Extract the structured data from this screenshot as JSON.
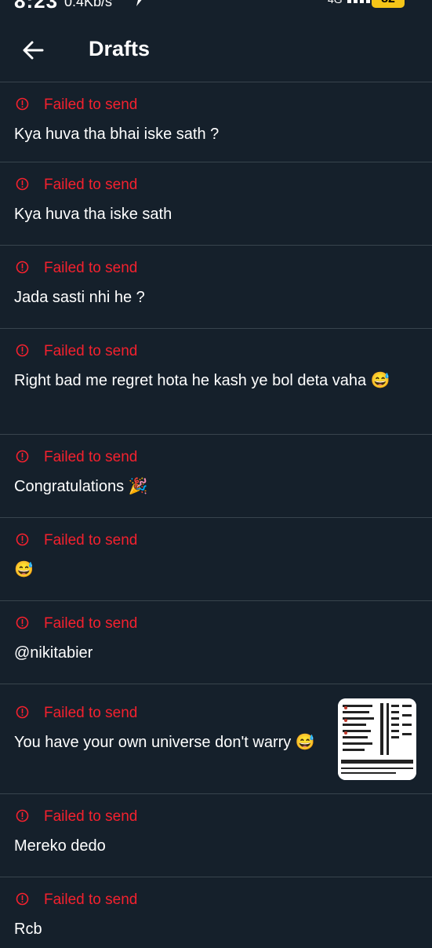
{
  "status_bar": {
    "time": "8:23",
    "net_speed": "0.4Kb/s",
    "network": "4G",
    "battery": "82"
  },
  "header": {
    "title": "Drafts"
  },
  "drafts": [
    {
      "status": "Failed to send",
      "text": "Kya huva tha bhai iske sath ?"
    },
    {
      "status": "Failed to send",
      "text": "Kya huva tha iske sath"
    },
    {
      "status": "Failed to send",
      "text": "Jada sasti nhi he ?"
    },
    {
      "status": "Failed to send",
      "text": "Right bad me regret hota he kash ye bol deta vaha 😅"
    },
    {
      "status": "Failed to send",
      "text": "Congratulations 🎉"
    },
    {
      "status": "Failed to send",
      "text": "😅"
    },
    {
      "status": "Failed to send",
      "text": "@nikitabier"
    },
    {
      "status": "Failed to send",
      "text": "You have your own universe don't warry 😅",
      "has_image": true
    },
    {
      "status": "Failed to send",
      "text": "Mereko dedo"
    },
    {
      "status": "Failed to send",
      "text": "Rcb"
    }
  ],
  "colors": {
    "background": "#15202b",
    "divider": "#38444d",
    "error": "#f4212e",
    "text": "#ffffff",
    "battery": "#f5c518"
  },
  "icons": {
    "back": "arrow-left-icon",
    "error": "alert-circle-icon",
    "charging": "lightning-icon",
    "signal": "signal-bars-icon"
  }
}
